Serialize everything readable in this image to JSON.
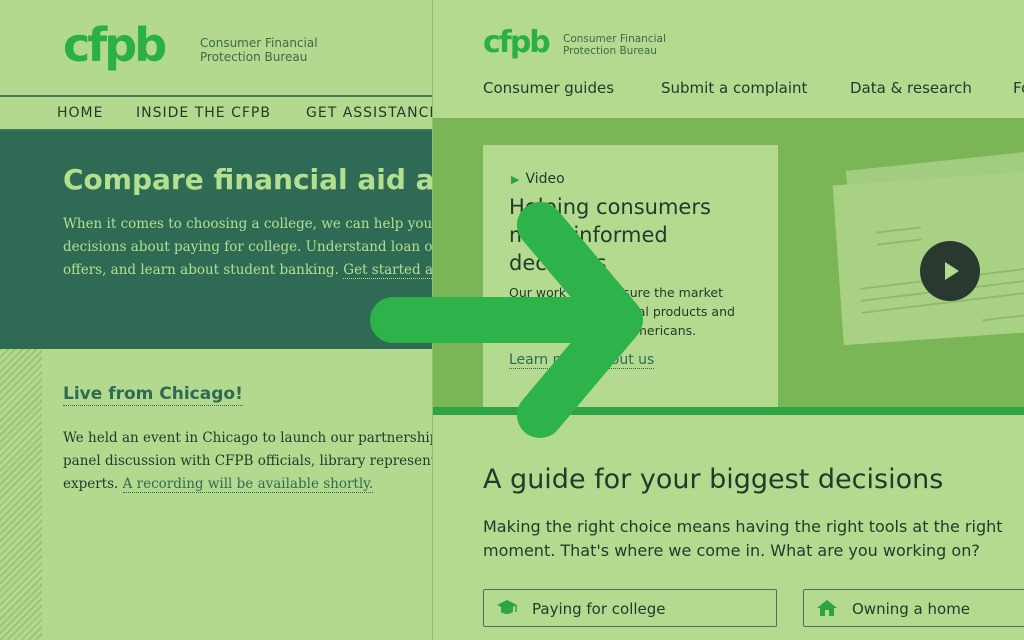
{
  "old_site": {
    "logo": "cfpb",
    "tagline_line1": "Consumer Financial",
    "tagline_line2": "Protection Bureau",
    "nav": [
      "HOME",
      "INSIDE THE CFPB",
      "GET ASSISTANCE"
    ],
    "hero": {
      "title": "Compare financial aid and",
      "line1": "When it comes to choosing a college,  we can help you",
      "line2": "decisions about paying for college. Understand loan op",
      "line3": "offers, and learn about student banking.",
      "link": "Get started an"
    },
    "live": {
      "title": "Live from Chicago!",
      "line1": "We held an event in Chicago to launch our partnership",
      "line2": "panel discussion with CFPB officials, library represent",
      "line3": "experts.",
      "link": "A recording will be available shortly."
    }
  },
  "new_site": {
    "logo": "cfpb",
    "tagline_line1": "Consumer Financial",
    "tagline_line2": "Protection Bureau",
    "nav": [
      "Consumer guides",
      "Submit a complaint",
      "Data & research",
      "Fo"
    ],
    "hero_card": {
      "label": "Video",
      "title_line1": "Helping consumers",
      "title_line2": "make informed",
      "title_line3": "decisions",
      "text_line1": "Our work helps ensure the market",
      "text_line2": "for consumer financial products and",
      "text_line3": "services works for Americans.",
      "link": "Learn more about us"
    },
    "guide": {
      "title": "A guide for your biggest decisions",
      "line1": "Making the right choice means having the right tools at the right",
      "line2": "moment. That's where we come in. What are you working on?"
    },
    "buttons": [
      "Paying for college",
      "Owning a home"
    ]
  },
  "colors": {
    "brand_green": "#2bb043",
    "dark_green": "#2f6a55",
    "arrow_green": "#2db34a"
  },
  "icons": [
    "play-icon",
    "graduation-cap-icon",
    "house-icon",
    "arrow-right-icon"
  ]
}
